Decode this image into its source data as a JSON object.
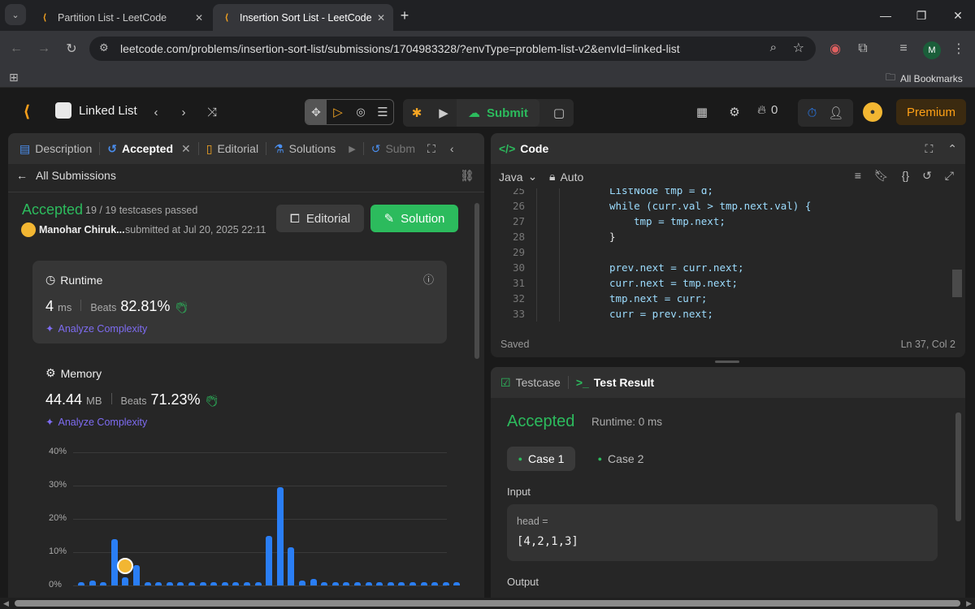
{
  "browser": {
    "tabs": [
      {
        "title": "Partition List - LeetCode",
        "active": false
      },
      {
        "title": "Insertion Sort List - LeetCode",
        "active": true
      }
    ],
    "url": "leetcode.com/problems/insertion-sort-list/submissions/1704983328/?envType=problem-list-v2&envId=linked-list",
    "profile_initial": "M",
    "bookmarks_label": "All Bookmarks"
  },
  "lc_header": {
    "problem_list": "Linked List",
    "submit_label": "Submit",
    "streak": "0",
    "premium_label": "Premium"
  },
  "left_panel": {
    "tabs": [
      "Description",
      "Accepted",
      "Editorial",
      "Solutions",
      "Subm"
    ],
    "back_label": "All Submissions",
    "status": "Accepted",
    "testcases": "19 / 19 testcases passed",
    "author": "Manohar Chiruk...",
    "submitted_at": "submitted at Jul 20, 2025 22:11",
    "editorial_btn": "Editorial",
    "solution_btn": "Solution",
    "runtime": {
      "title": "Runtime",
      "value": "4",
      "unit": "ms",
      "beats_label": "Beats",
      "beats": "82.81%",
      "analyze": "Analyze Complexity"
    },
    "memory": {
      "title": "Memory",
      "value": "44.44",
      "unit": "MB",
      "beats_label": "Beats",
      "beats": "71.23%",
      "analyze": "Analyze Complexity"
    }
  },
  "chart_data": {
    "type": "bar",
    "yticks": [
      "40%",
      "30%",
      "20%",
      "10%",
      "0%"
    ],
    "ylim": [
      0,
      40
    ],
    "values": [
      1,
      1.5,
      1,
      14,
      2.5,
      6,
      1,
      1,
      1,
      1,
      1,
      1,
      1,
      1,
      1,
      1,
      1,
      15,
      29.5,
      11.5,
      1.5,
      2,
      1,
      1,
      1,
      1,
      1,
      1,
      1,
      1,
      1,
      1,
      1,
      1,
      1
    ],
    "user_bar_index": 4
  },
  "code_panel": {
    "title": "Code",
    "language": "Java",
    "autosave": "Auto",
    "lines": [
      {
        "n": "25",
        "text": "ListNode tmp = d;"
      },
      {
        "n": "26",
        "text": "while (curr.val > tmp.next.val) {"
      },
      {
        "n": "27",
        "text": "tmp = tmp.next;"
      },
      {
        "n": "28",
        "text": "}"
      },
      {
        "n": "29",
        "text": ""
      },
      {
        "n": "30",
        "text": "prev.next = curr.next;"
      },
      {
        "n": "31",
        "text": "curr.next = tmp.next;"
      },
      {
        "n": "32",
        "text": "tmp.next = curr;"
      },
      {
        "n": "33",
        "text": "curr = prev.next;"
      }
    ],
    "saved": "Saved",
    "cursor": "Ln 37, Col 2"
  },
  "result_panel": {
    "tab_testcase": "Testcase",
    "tab_result": "Test Result",
    "status": "Accepted",
    "runtime": "Runtime: 0 ms",
    "cases": [
      "Case 1",
      "Case 2"
    ],
    "input_label": "Input",
    "var_name": "head =",
    "var_value": "[4,2,1,3]",
    "output_label": "Output"
  },
  "colors": {
    "accent_green": "#2cbb5d",
    "premium": "#ffa116",
    "bar_blue": "#2a7ef5"
  }
}
